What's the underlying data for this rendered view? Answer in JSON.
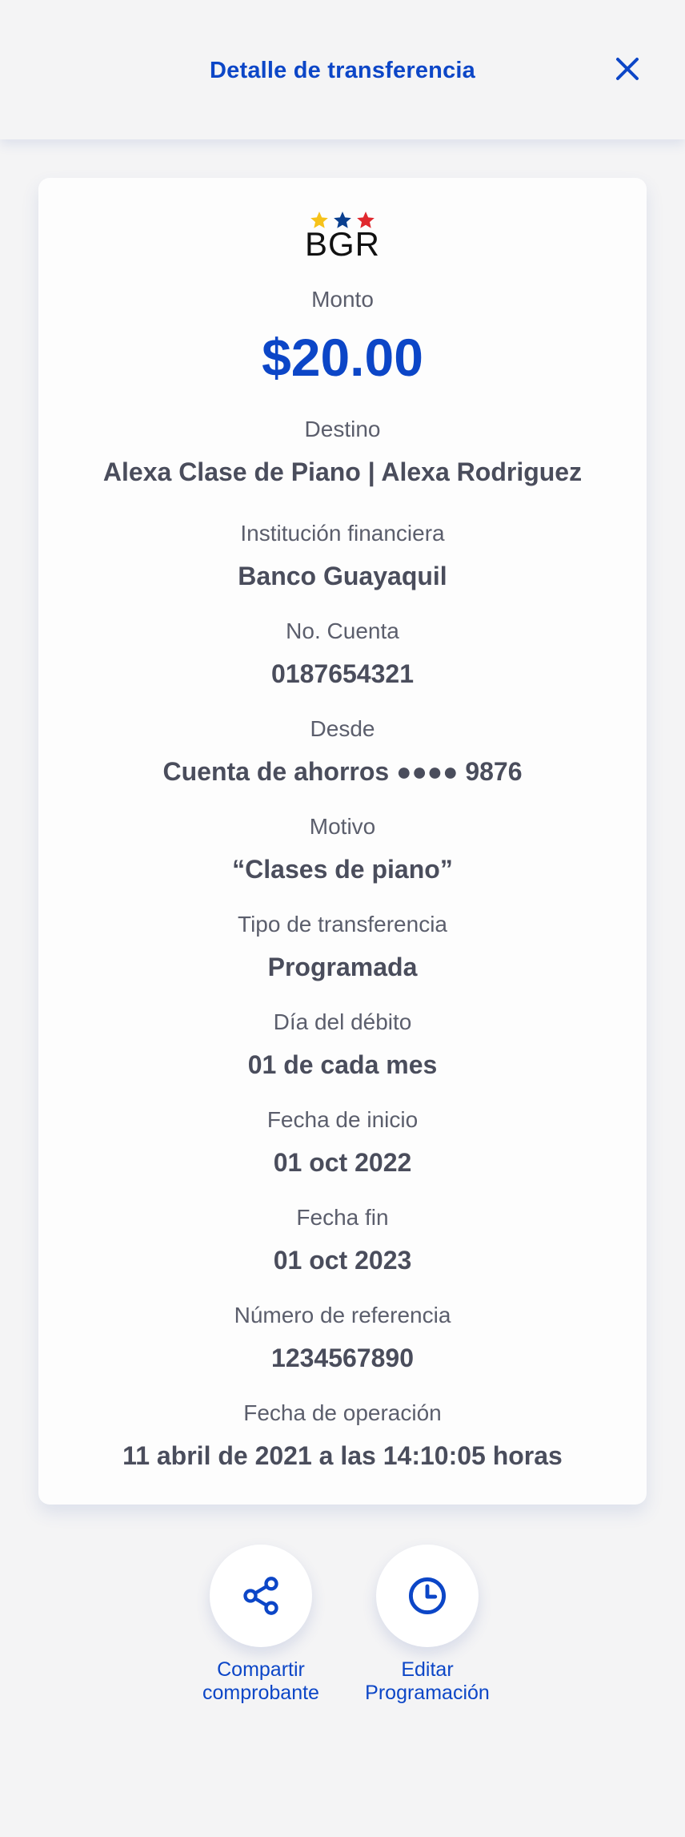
{
  "header": {
    "title": "Detalle de transferencia",
    "close_icon": "close-icon"
  },
  "brand": {
    "name": "BGR",
    "star_colors": [
      "#f6c21a",
      "#0a3f8f",
      "#e0282e"
    ]
  },
  "colors": {
    "accent": "#0c46c7",
    "label": "#5b5e6c",
    "value": "#4a4d5c"
  },
  "amount": {
    "label": "Monto",
    "value": "$20.00"
  },
  "details": [
    {
      "label": "Destino",
      "value": "Alexa Clase de Piano | Alexa Rodriguez"
    },
    {
      "label": "Institución financiera",
      "value": "Banco Guayaquil"
    },
    {
      "label": "No. Cuenta",
      "value": "0187654321"
    },
    {
      "label": "Desde",
      "value": "Cuenta de ahorros ●●●● 9876"
    },
    {
      "label": "Motivo",
      "value": "“Clases de piano”"
    },
    {
      "label": "Tipo de transferencia",
      "value": "Programada"
    },
    {
      "label": "Día del débito",
      "value": "01 de cada mes"
    },
    {
      "label": "Fecha de inicio",
      "value": "01 oct 2022"
    },
    {
      "label": "Fecha fin",
      "value": "01 oct 2023"
    },
    {
      "label": "Número de referencia",
      "value": "1234567890"
    },
    {
      "label": "Fecha de operación",
      "value": "11 abril de 2021 a las 14:10:05 horas"
    }
  ],
  "actions": [
    {
      "label": "Compartir\ncomprobante",
      "icon": "share-icon"
    },
    {
      "label": "Editar\nProgramación",
      "icon": "clock-icon"
    }
  ]
}
